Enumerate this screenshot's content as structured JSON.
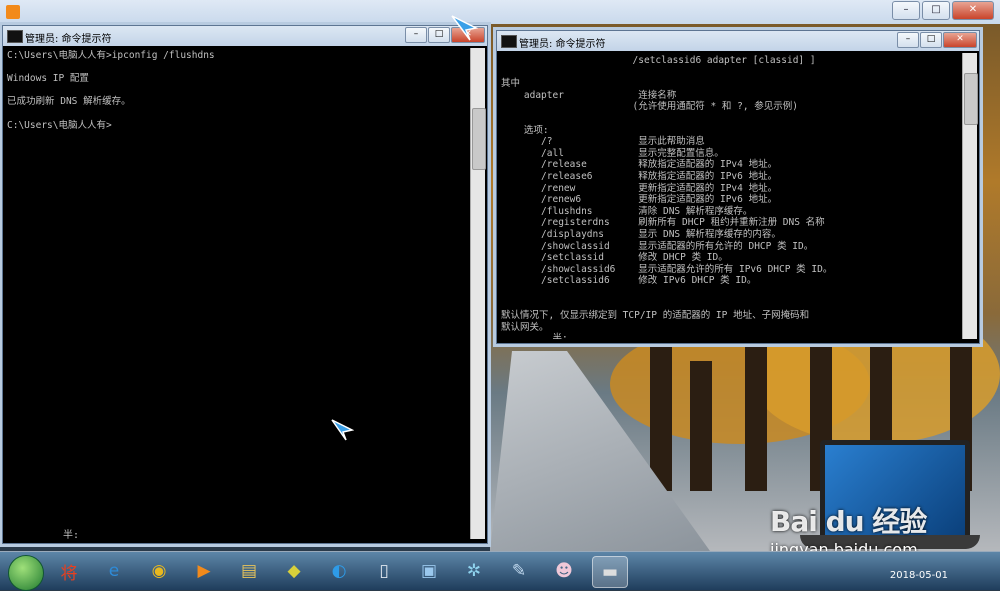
{
  "outer_window": {
    "title": "",
    "controls": [
      "–",
      "□",
      "✕"
    ]
  },
  "left_console": {
    "title": "管理员: 命令提示符",
    "lines": [
      "C:\\Users\\电脑人人有>ipconfig /flushdns",
      "",
      "Windows IP 配置",
      "",
      "已成功刷新 DNS 解析缓存。",
      "",
      "C:\\Users\\电脑人人有>"
    ],
    "status_line": "半:"
  },
  "right_console": {
    "title": "管理员: 命令提示符",
    "lines": [
      "                       /setclassid6 adapter [classid] ]",
      "",
      "其中",
      "    adapter             连接名称",
      "                       (允许使用通配符 * 和 ?, 参见示例)",
      "",
      "    选项:",
      "       /?               显示此帮助消息",
      "       /all             显示完整配置信息。",
      "       /release         释放指定适配器的 IPv4 地址。",
      "       /release6        释放指定适配器的 IPv6 地址。",
      "       /renew           更新指定适配器的 IPv4 地址。",
      "       /renew6          更新指定适配器的 IPv6 地址。",
      "       /flushdns        清除 DNS 解析程序缓存。",
      "       /registerdns     刷新所有 DHCP 租约并重新注册 DNS 名称",
      "       /displaydns      显示 DNS 解析程序缓存的内容。",
      "       /showclassid     显示适配器的所有允许的 DHCP 类 ID。",
      "       /setclassid      修改 DHCP 类 ID。",
      "       /showclassid6    显示适配器允许的所有 IPv6 DHCP 类 ID。",
      "       /setclassid6     修改 IPv6 DHCP 类 ID。",
      "",
      "",
      "默认情况下, 仅显示绑定到 TCP/IP 的适配器的 IP 地址、子网掩码和",
      "默认网关。",
      "         半:"
    ]
  },
  "watermark": {
    "brand": "Bai du 经验",
    "url": "jingyan.baidu.com"
  },
  "taskbar": {
    "items": [
      {
        "name": "360-icon",
        "glyph": "将",
        "color": "#e8401f"
      },
      {
        "name": "ie-icon",
        "glyph": "e",
        "color": "#2e8bd8"
      },
      {
        "name": "chrome-icon",
        "glyph": "◉",
        "color": "#e8b81f"
      },
      {
        "name": "media-player-icon",
        "glyph": "▶",
        "color": "#f28a1b"
      },
      {
        "name": "file-explorer-icon",
        "glyph": "▤",
        "color": "#e8c45a"
      },
      {
        "name": "folder-icon",
        "glyph": "◆",
        "color": "#d8d03a"
      },
      {
        "name": "browser-icon",
        "glyph": "◐",
        "color": "#2e9be8"
      },
      {
        "name": "document-icon",
        "glyph": "▯",
        "color": "#dfe6ee"
      },
      {
        "name": "remote-desktop-icon",
        "glyph": "▣",
        "color": "#9ac8ee"
      },
      {
        "name": "network-icon",
        "glyph": "✲",
        "color": "#8fd3ee"
      },
      {
        "name": "paint-icon",
        "glyph": "✎",
        "color": "#c0d8ee"
      },
      {
        "name": "app-icon",
        "glyph": "☻",
        "color": "#f0c8d8"
      },
      {
        "name": "cmd-icon",
        "glyph": "▬",
        "color": "#dddddd"
      }
    ],
    "clock_date": "2018-05-01"
  }
}
